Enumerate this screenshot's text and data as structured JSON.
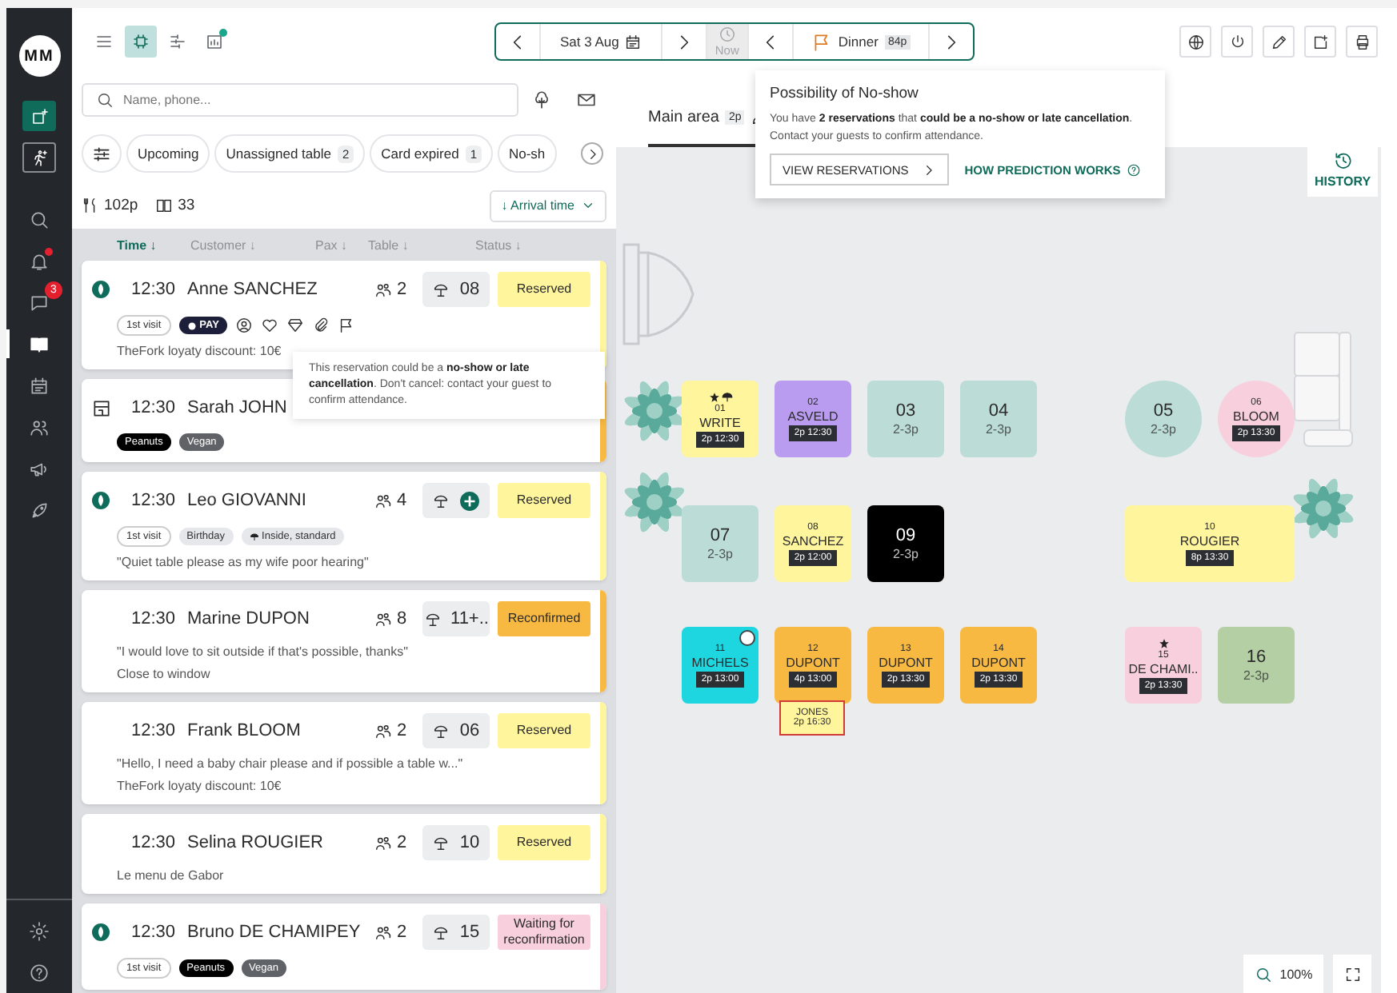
{
  "sidebar": {
    "logo": "MM",
    "actions": [
      {
        "kind": "booking",
        "selected": true
      },
      {
        "kind": "walkin",
        "selected": false
      }
    ],
    "items": [
      {
        "kind": "search",
        "selected": false,
        "dot": false
      },
      {
        "kind": "bell",
        "selected": false,
        "dot": true
      },
      {
        "kind": "chat",
        "selected": false,
        "dot": false,
        "badge": "3"
      },
      {
        "kind": "book",
        "selected": true,
        "dot": false
      },
      {
        "kind": "calendar",
        "selected": false,
        "dot": false
      },
      {
        "kind": "people",
        "selected": false,
        "dot": false
      },
      {
        "kind": "megaphone",
        "selected": false,
        "dot": false
      },
      {
        "kind": "rocket",
        "selected": false,
        "dot": false
      }
    ],
    "bottom": [
      {
        "kind": "gear"
      },
      {
        "kind": "help"
      }
    ]
  },
  "toolbar": {
    "views": [
      {
        "kind": "list",
        "selected": false,
        "dot": false
      },
      {
        "kind": "floor",
        "selected": true,
        "dot": false
      },
      {
        "kind": "timeline",
        "selected": false,
        "dot": false
      },
      {
        "kind": "stats",
        "selected": false,
        "dot": true
      }
    ],
    "date": "Sat 3 Aug",
    "now": "Now",
    "now_disabled": true,
    "service": "Dinner",
    "service_count": "84p",
    "actions": [
      {
        "kind": "globe"
      },
      {
        "kind": "power"
      },
      {
        "kind": "pencil"
      },
      {
        "kind": "note"
      },
      {
        "kind": "printer"
      }
    ]
  },
  "popover": {
    "title": "Possibility of No-show",
    "text": "You have **2 reservations** that **could be a no-show or late cancellation**. Contact your guests to confirm attendance.",
    "button": "VIEW RESERVATIONS",
    "link": "HOW PREDICTION WORKS"
  },
  "list": {
    "search_placeholder": "Name, phone...",
    "filters": [
      {
        "label": "Upcoming"
      },
      {
        "label": "Unassigned table",
        "count": "2"
      },
      {
        "label": "Card expired",
        "count": "1"
      },
      {
        "label": "No-sh"
      }
    ],
    "covers": "102p",
    "bookings": "33",
    "sort": "↓ Arrival time",
    "columns": [
      {
        "label": "Time ↓",
        "selected": true
      },
      {
        "label": "Customer ↓",
        "selected": false
      },
      {
        "label": "Pax ↓",
        "selected": false
      },
      {
        "label": "Table ↓",
        "selected": false
      },
      {
        "label": "Status ↓",
        "selected": false
      }
    ],
    "reservations": [
      {
        "kind": "fork",
        "time": "12:30",
        "name": "Anne SANCHEZ",
        "pax": "2",
        "table": "08",
        "status": "Reserved",
        "color": "#fff59d",
        "tags": [
          {
            "label": "1st visit",
            "kind": "outline"
          },
          {
            "label": "PAY",
            "kind": "pay"
          }
        ],
        "indicators": [
          {
            "kind": "guest"
          },
          {
            "kind": "heart"
          },
          {
            "kind": "gift"
          },
          {
            "kind": "clip"
          },
          {
            "kind": "flag"
          }
        ],
        "notes": [
          "TheFork loyaty discount: 10€"
        ]
      },
      {
        "kind": "widget",
        "time": "12:30",
        "name": "Sarah JOHN",
        "color": "#f7b941",
        "tags": [
          {
            "label": "Peanuts",
            "kind": "black"
          },
          {
            "label": "Vegan",
            "kind": "gray"
          }
        ]
      },
      {
        "kind": "fork",
        "time": "12:30",
        "name": "Leo GIOVANNI",
        "pax": "4",
        "status": "Reserved",
        "color": "#fff59d",
        "tags": [
          {
            "label": "1st visit",
            "kind": "outline"
          },
          {
            "label": "Birthday",
            "kind": "light"
          },
          {
            "label": "Inside, standard",
            "kind": "area"
          }
        ],
        "notes": [
          "\"Quiet table please as my wife poor hearing\""
        ]
      },
      {
        "kind": "none",
        "time": "12:30",
        "name": "Marine DUPON",
        "pax": "8",
        "table": "11+..",
        "status": "Reconfirmed",
        "color": "#f7b941",
        "notes": [
          "\"I would love to sit outside if that's possible, thanks\"",
          "Close to window"
        ]
      },
      {
        "kind": "none",
        "time": "12:30",
        "name": "Frank BLOOM",
        "pax": "2",
        "table": "06",
        "status": "Reserved",
        "color": "#fff59d",
        "notes": [
          "\"Hello, I need a baby chair please and if possible a table w...\"",
          "TheFork loyaty discount: 10€"
        ]
      },
      {
        "kind": "none",
        "time": "12:30",
        "name": "Selina ROUGIER",
        "pax": "2",
        "table": "10",
        "status": "Reserved",
        "color": "#fff59d",
        "notes": [
          "Le menu de Gabor"
        ]
      },
      {
        "kind": "fork",
        "time": "12:30",
        "name": "Bruno DE CHAMIPEY",
        "pax": "2",
        "table": "15",
        "status": "Waiting for reconfirmation",
        "color": "#f8cfdd",
        "tags": [
          {
            "label": "1st visit",
            "kind": "outline"
          },
          {
            "label": "Peanuts",
            "kind": "black"
          },
          {
            "label": "Vegan",
            "kind": "gray"
          }
        ]
      }
    ],
    "tooltip": "This reservation could be a **no-show or late cancellation**. Don't cancel: contact your guest to confirm attendance."
  },
  "floor": {
    "area": "Main area",
    "area_count": "2p",
    "history": "HISTORY",
    "zoom": "100%",
    "tables": [
      {
        "number": "01",
        "name": "WRITE",
        "badge": "2p 12:30",
        "color": "#fff59d",
        "kind": "square",
        "starred": true,
        "outdoor": true,
        "timer": false
      },
      {
        "number": "02",
        "name": "ASVELD",
        "badge": "2p 12:30",
        "color": "#b99cf0",
        "kind": "square",
        "starred": false,
        "outdoor": false,
        "timer": false
      },
      {
        "number": "03",
        "capacity": "2-3p",
        "color": "#bcdcd8",
        "kind": "square",
        "starred": false,
        "outdoor": false,
        "timer": false
      },
      {
        "number": "04",
        "capacity": "2-3p",
        "color": "#bcdcd8",
        "kind": "square",
        "starred": false,
        "outdoor": false,
        "timer": false
      },
      {
        "number": "05",
        "capacity": "2-3p",
        "color": "#bcdcd8",
        "kind": "round",
        "starred": false,
        "outdoor": false,
        "timer": false
      },
      {
        "number": "06",
        "name": "BLOOM",
        "badge": "2p 13:30",
        "color": "#f8cfdd",
        "kind": "round",
        "starred": false,
        "outdoor": false,
        "timer": false
      },
      {
        "number": "07",
        "capacity": "2-3p",
        "color": "#bcdcd8",
        "kind": "square",
        "starred": false,
        "outdoor": false,
        "timer": false
      },
      {
        "number": "08",
        "name": "SANCHEZ",
        "badge": "2p 12:00",
        "color": "#fff59d",
        "kind": "square",
        "starred": false,
        "outdoor": false,
        "timer": false
      },
      {
        "number": "09",
        "capacity": "2-3p",
        "color": "#000000",
        "kind": "square",
        "starred": false,
        "outdoor": false,
        "timer": false
      },
      {
        "number": "10",
        "name": "ROUGIER",
        "badge": "8p 13:30",
        "color": "#fff59d",
        "kind": "wide",
        "starred": false,
        "outdoor": false,
        "timer": false
      },
      {
        "number": "11",
        "name": "MICHELS",
        "badge": "2p 13:00",
        "color": "#1ed6e0",
        "kind": "square",
        "starred": false,
        "outdoor": false,
        "timer": true
      },
      {
        "number": "12",
        "name": "DUPONT",
        "badge": "4p 13:00",
        "color": "#f7b941",
        "kind": "square",
        "starred": false,
        "outdoor": false,
        "timer": false,
        "waiting": {
          "name": "JONES",
          "badge": "2p 16:30"
        }
      },
      {
        "number": "13",
        "name": "DUPONT",
        "badge": "2p 13:30",
        "color": "#f7b941",
        "kind": "square",
        "starred": false,
        "outdoor": false,
        "timer": false
      },
      {
        "number": "14",
        "name": "DUPONT",
        "badge": "2p 13:30",
        "color": "#f7b941",
        "kind": "square",
        "starred": false,
        "outdoor": false,
        "timer": false
      },
      {
        "number": "15",
        "name": "DE CHAMI..",
        "badge": "2p 13:30",
        "color": "#f8cfdd",
        "kind": "square",
        "starred": true,
        "outdoor": false,
        "timer": false
      },
      {
        "number": "16",
        "capacity": "2-3p",
        "color": "#b5cfa5",
        "kind": "square",
        "starred": false,
        "outdoor": false,
        "timer": false
      }
    ]
  }
}
